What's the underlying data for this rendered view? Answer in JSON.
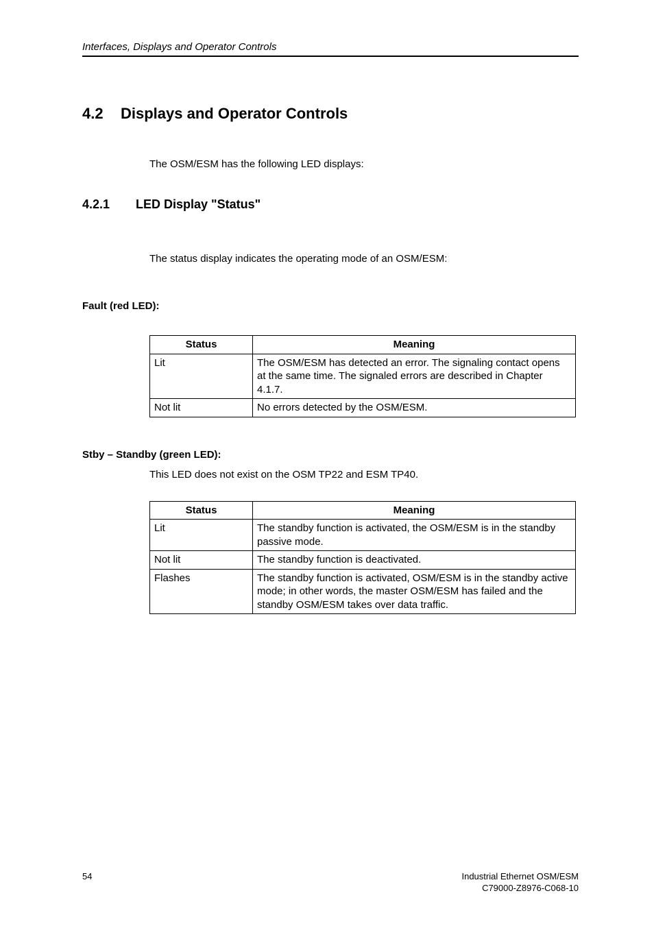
{
  "header": "Interfaces, Displays and Operator Controls",
  "section": {
    "num": "4.2",
    "title": "Displays and Operator Controls"
  },
  "intro": "The OSM/ESM has the following LED displays:",
  "subsection": {
    "num": "4.2.1",
    "title": "LED Display \"Status\""
  },
  "status_para": "The status display indicates the operating mode of an OSM/ESM:",
  "fault": {
    "label": "Fault (red LED):",
    "headers": {
      "status": "Status",
      "meaning": "Meaning"
    },
    "rows": [
      {
        "status": "Lit",
        "meaning": "The OSM/ESM has detected an error. The signaling contact opens at the same time. The signaled errors are described in Chapter 4.1.7."
      },
      {
        "status": "Not lit",
        "meaning": "No errors detected by the OSM/ESM."
      }
    ]
  },
  "stby": {
    "label": "Stby – Standby (green LED):",
    "note": "This LED does not exist on the OSM TP22 and ESM TP40.",
    "headers": {
      "status": "Status",
      "meaning": "Meaning"
    },
    "rows": [
      {
        "status": "Lit",
        "meaning": "The standby function is activated, the OSM/ESM is in the standby passive mode."
      },
      {
        "status": "Not lit",
        "meaning": "The standby function is deactivated."
      },
      {
        "status": "Flashes",
        "meaning": "The standby function is activated, OSM/ESM is in the standby active mode; in other words, the master OSM/ESM has failed and the standby OSM/ESM takes over data traffic."
      }
    ]
  },
  "footer": {
    "page": "54",
    "right1": "Industrial Ethernet OSM/ESM",
    "right2": "C79000-Z8976-C068-10"
  }
}
